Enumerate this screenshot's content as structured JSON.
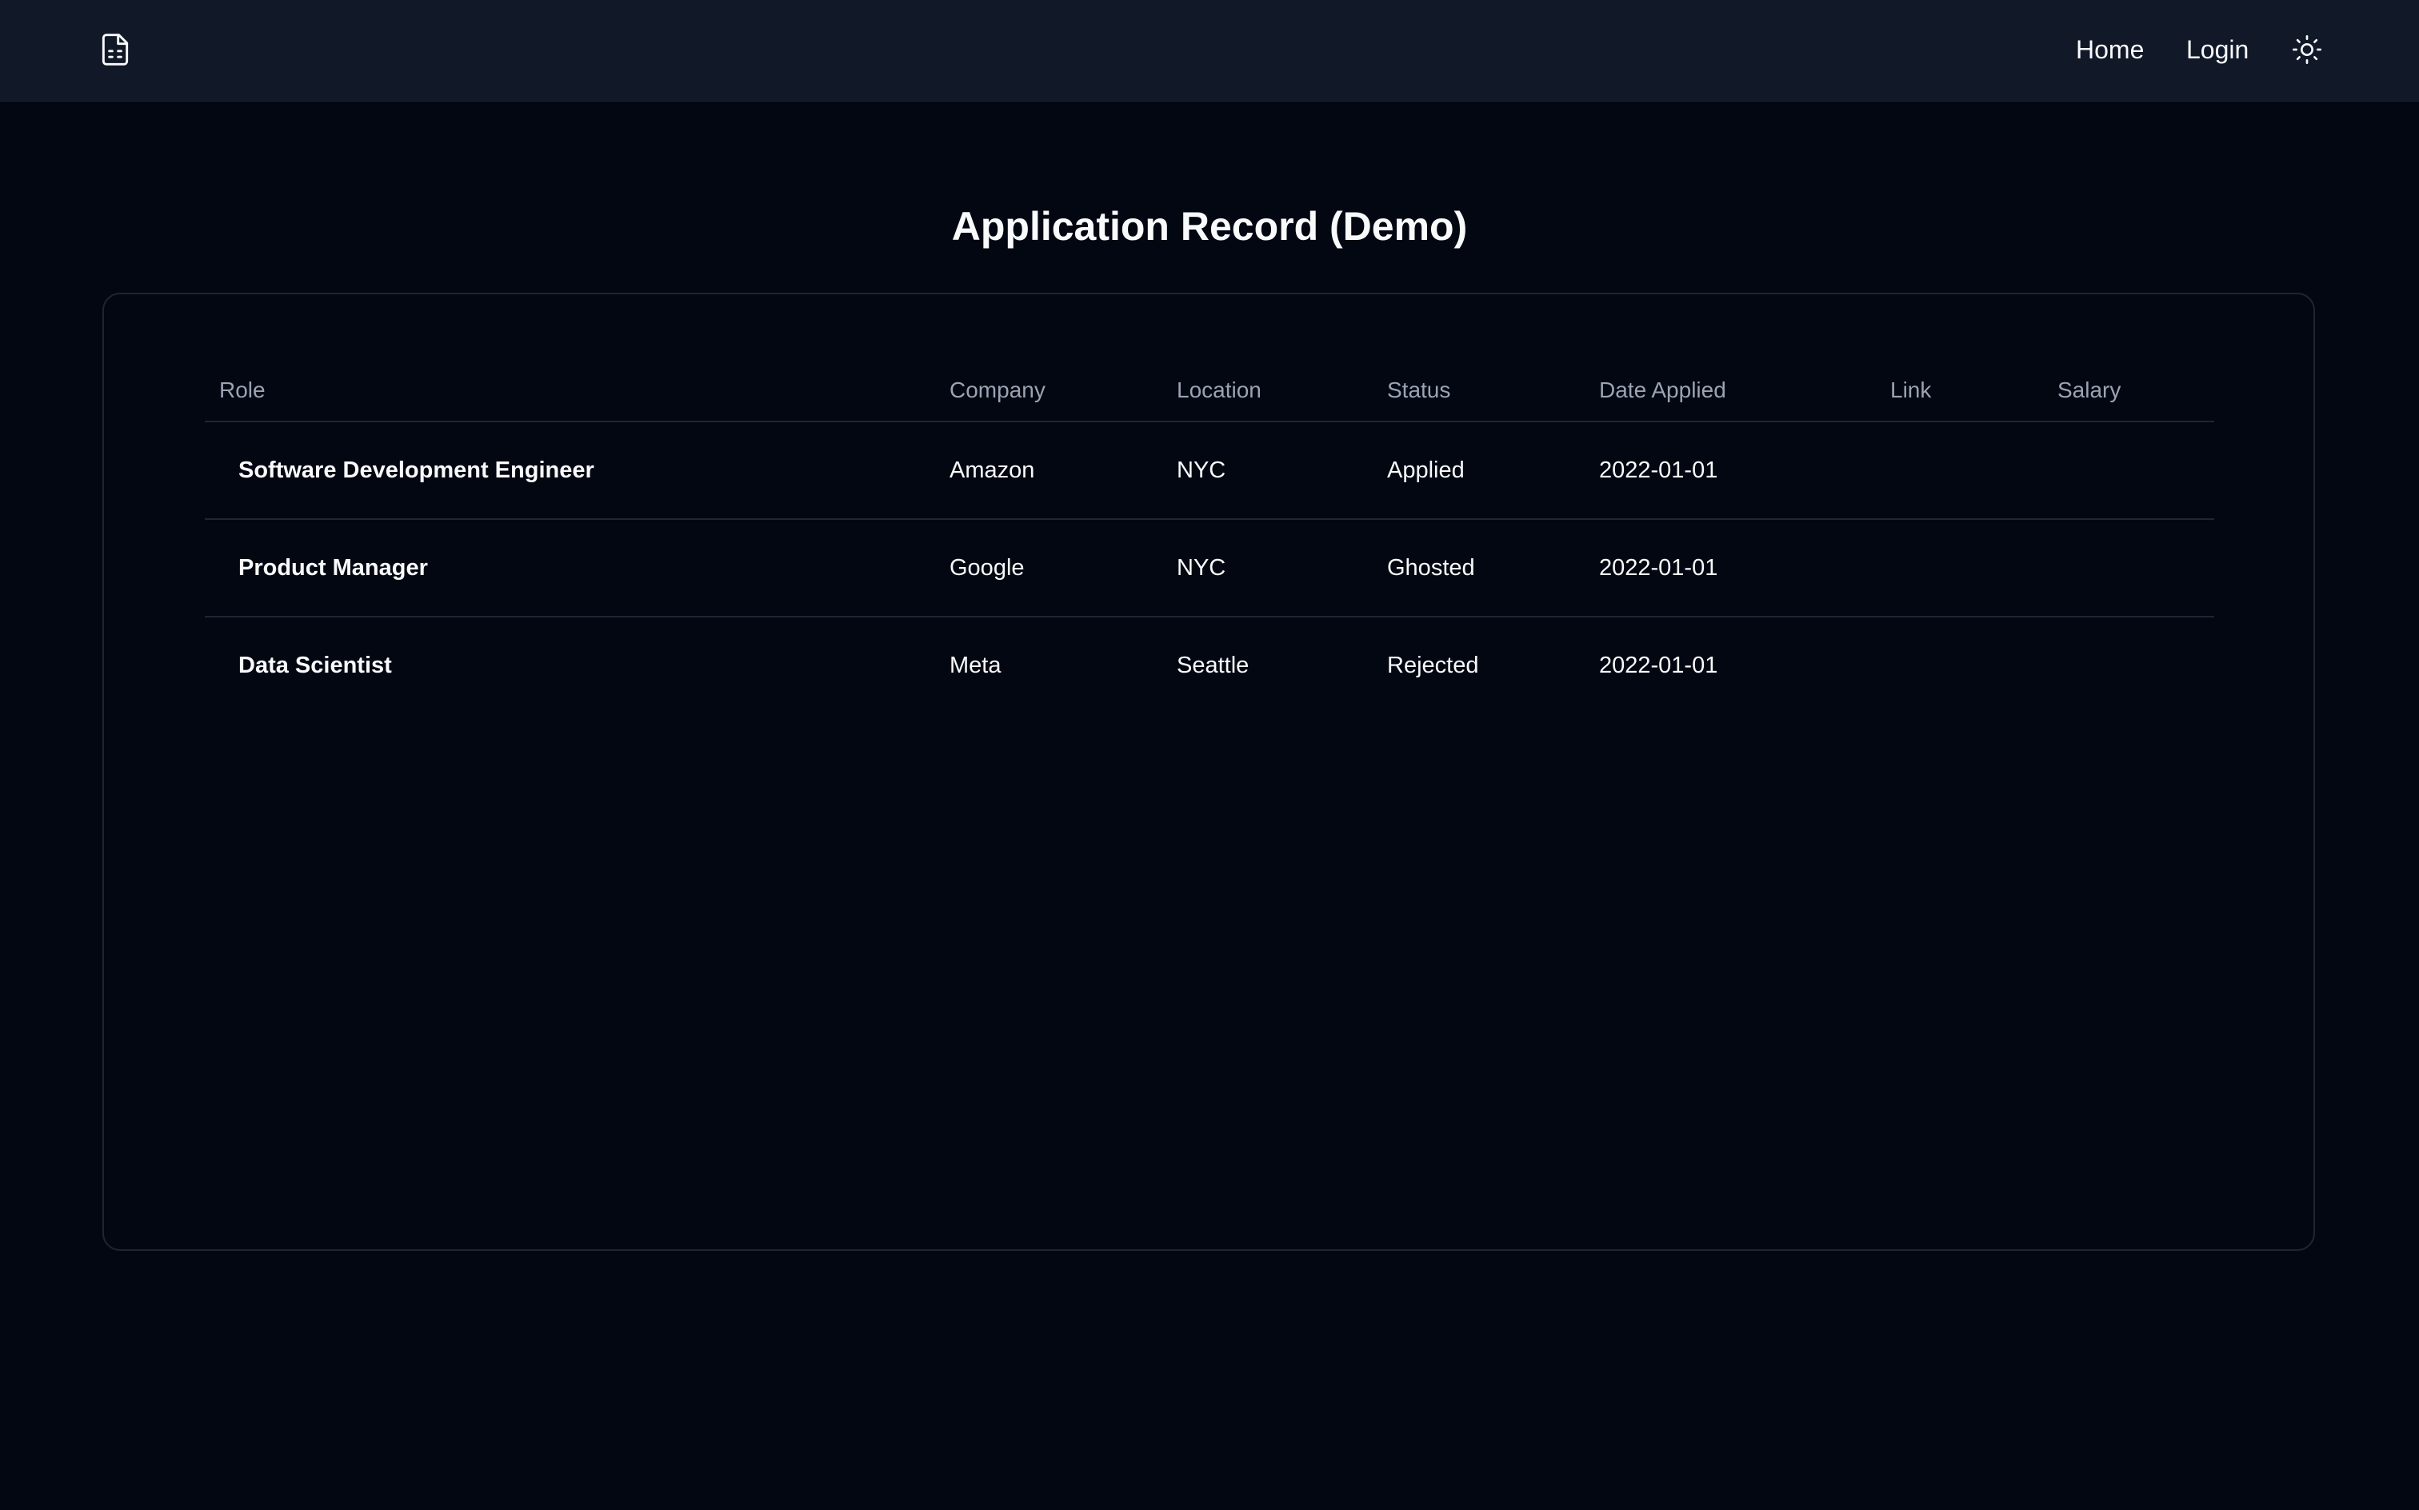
{
  "nav": {
    "logo_icon": "file-spreadsheet-icon",
    "home_label": "Home",
    "login_label": "Login",
    "theme_icon": "sun-icon"
  },
  "page": {
    "title": "Application Record (Demo)"
  },
  "table": {
    "headers": [
      "Role",
      "Company",
      "Location",
      "Status",
      "Date Applied",
      "Link",
      "Salary"
    ],
    "rows": [
      {
        "role": "Software Development Engineer",
        "company": "Amazon",
        "location": "NYC",
        "status": "Applied",
        "date_applied": "2022-01-01",
        "link": "",
        "salary": ""
      },
      {
        "role": "Product Manager",
        "company": "Google",
        "location": "NYC",
        "status": "Ghosted",
        "date_applied": "2022-01-01",
        "link": "",
        "salary": ""
      },
      {
        "role": "Data Scientist",
        "company": "Meta",
        "location": "Seattle",
        "status": "Rejected",
        "date_applied": "2022-01-01",
        "link": "",
        "salary": ""
      }
    ]
  },
  "colors": {
    "background": "#030711",
    "navbar": "#111827",
    "border": "#1e2533",
    "text": "#f8fafc",
    "muted_text": "#9ba3b4"
  }
}
